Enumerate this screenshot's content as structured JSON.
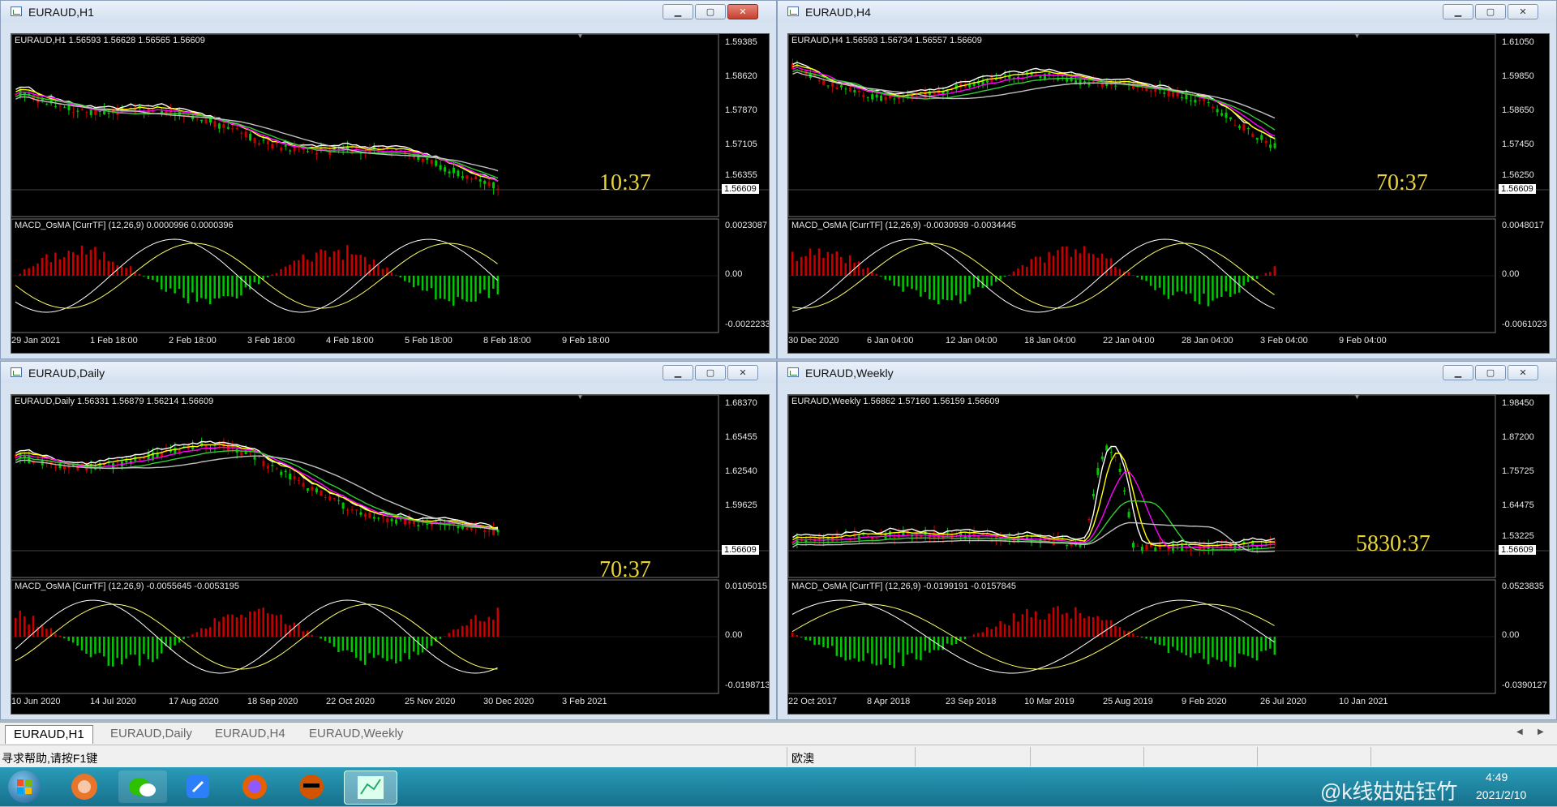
{
  "windows": [
    {
      "title": "EURAUD,H1",
      "ohlc_label": "EURAUD,H1  1.56593 1.56628 1.56565 1.56609",
      "price_ticks": [
        "1.59385",
        "1.58620",
        "1.57870",
        "1.57105",
        "1.56355"
      ],
      "current_price": "1.56609",
      "timer": "10:37",
      "macd_label": "MACD_OsMA [CurrTF] (12,26,9) 0.0000996 0.0000396",
      "macd_ticks": [
        "0.0023087",
        "0.00",
        "-0.0022233"
      ],
      "time_ticks": [
        "29 Jan 2021",
        "1 Feb 18:00",
        "2 Feb 18:00",
        "3 Feb 18:00",
        "4 Feb 18:00",
        "5 Feb 18:00",
        "8 Feb 18:00",
        "9 Feb 18:00"
      ],
      "close_active": true
    },
    {
      "title": "EURAUD,H4",
      "ohlc_label": "EURAUD,H4  1.56593 1.56734 1.56557 1.56609",
      "price_ticks": [
        "1.61050",
        "1.59850",
        "1.58650",
        "1.57450",
        "1.56250"
      ],
      "current_price": "1.56609",
      "timer": "70:37",
      "macd_label": "MACD_OsMA [CurrTF] (12,26,9) -0.0030939 -0.0034445",
      "macd_ticks": [
        "0.0048017",
        "0.00",
        "-0.0061023"
      ],
      "time_ticks": [
        "30 Dec 2020",
        "6 Jan 04:00",
        "12 Jan 04:00",
        "18 Jan 04:00",
        "22 Jan 04:00",
        "28 Jan 04:00",
        "3 Feb 04:00",
        "9 Feb 04:00"
      ],
      "close_active": false
    },
    {
      "title": "EURAUD,Daily",
      "ohlc_label": "EURAUD,Daily  1.56331 1.56879 1.56214 1.56609",
      "price_ticks": [
        "1.68370",
        "1.65455",
        "1.62540",
        "1.59625",
        ""
      ],
      "current_price": "1.56609",
      "timer": "70:37",
      "macd_label": "MACD_OsMA [CurrTF] (12,26,9) -0.0055645 -0.0053195",
      "macd_ticks": [
        "0.0105015",
        "0.00",
        "-0.0198713"
      ],
      "time_ticks": [
        "10 Jun 2020",
        "14 Jul 2020",
        "17 Aug 2020",
        "18 Sep 2020",
        "22 Oct 2020",
        "25 Nov 2020",
        "30 Dec 2020",
        "3 Feb 2021"
      ],
      "close_active": false
    },
    {
      "title": "EURAUD,Weekly",
      "ohlc_label": "EURAUD,Weekly  1.56862 1.57160 1.56159 1.56609",
      "price_ticks": [
        "1.98450",
        "1.87200",
        "1.75725",
        "1.64475",
        "1.53225"
      ],
      "current_price": "1.56609",
      "timer": "5830:37",
      "macd_label": "MACD_OsMA [CurrTF] (12,26,9) -0.0199191 -0.0157845",
      "macd_ticks": [
        "0.0523835",
        "0.00",
        "-0.0390127"
      ],
      "time_ticks": [
        "22 Oct 2017",
        "8 Apr 2018",
        "23 Sep 2018",
        "10 Mar 2019",
        "25 Aug 2019",
        "9 Feb 2020",
        "26 Jul 2020",
        "10 Jan 2021"
      ],
      "close_active": false
    }
  ],
  "tabs": [
    "EURAUD,H1",
    "EURAUD,Daily",
    "EURAUD,H4",
    "EURAUD,Weekly"
  ],
  "status": {
    "help": "寻求帮助,请按F1键",
    "profile": "欧澳"
  },
  "taskbar": {
    "time": "4:49",
    "date": "2021/2/10",
    "watermark": "@k线姑姑钰竹",
    "apps": [
      "start-orb-icon",
      "media-player-icon",
      "wechat-icon",
      "notes-icon",
      "firefox-icon",
      "app-icon",
      "trading-terminal-icon"
    ]
  },
  "colors": {
    "bull_candle": "#00c800",
    "bear_candle": "#c80000",
    "timer": "#e8d43a",
    "ma_white": "#ffffff",
    "ma_yellow": "#ffff00",
    "ma_magenta": "#ff00ff",
    "ma_green": "#32cd32",
    "ma_gray": "#c0c0c0"
  }
}
